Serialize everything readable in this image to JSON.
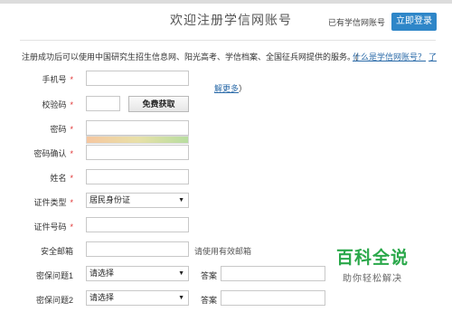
{
  "header": {
    "title": "欢迎注册学信网账号",
    "has_account": "已有学信网账号",
    "login_button": "立即登录"
  },
  "intro": {
    "text": "注册成功后可以使用中国研究生招生信息网、阳光高考、学信档案、全国征兵网提供的服务。(",
    "link1": "什么是学信网账号？",
    "link2": "了",
    "link2_cont": "解更多",
    "close_paren": "）"
  },
  "form": {
    "phone_label": "手机号",
    "code_label": "校验码",
    "code_button": "免费获取",
    "password_label": "密码",
    "confirm_label": "密码确认",
    "name_label": "姓名",
    "id_type_label": "证件类型",
    "id_type_value": "居民身份证",
    "id_number_label": "证件号码",
    "email_label": "安全邮箱",
    "email_hint": "请使用有效邮箱",
    "q1_label": "密保问题1",
    "q1_value": "请选择",
    "q2_label": "密保问题2",
    "q2_value": "请选择",
    "answer_label": "答案",
    "required_mark": "*"
  },
  "watermark": {
    "main": "百科全说",
    "sub": "助你轻松解决"
  }
}
